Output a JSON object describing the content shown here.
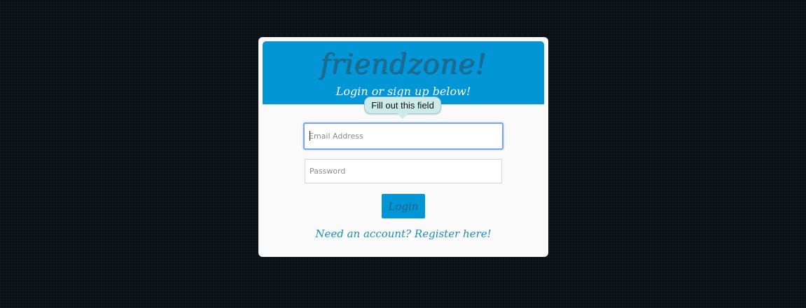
{
  "app": {
    "logo_text": "friendzone!",
    "subtitle": "Login or sign up below!"
  },
  "login_form": {
    "email_placeholder": "Email Address",
    "email_value": "",
    "password_placeholder": "Password",
    "password_value": "",
    "login_label": "Login",
    "register_link": "Need an account? Register here!"
  },
  "validation": {
    "tooltip_text": "Fill out this field"
  },
  "colors": {
    "background": "#0b0f12",
    "banner": "#0296d6",
    "logo": "#216a8e",
    "link": "#1a8ec2",
    "focus_ring": "#7aa7e6",
    "tooltip": "#cdeaea"
  }
}
